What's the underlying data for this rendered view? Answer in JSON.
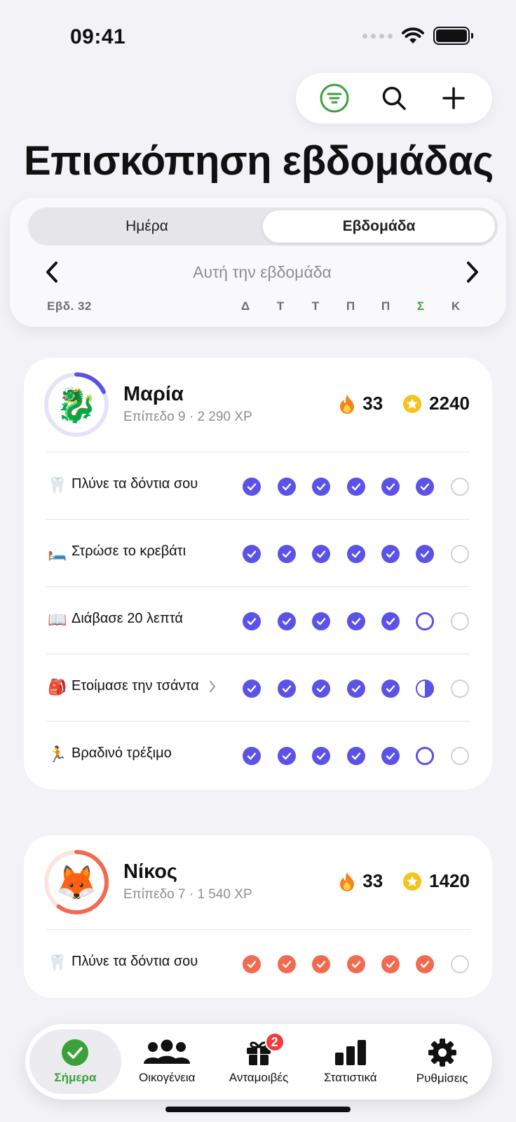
{
  "status_bar": {
    "time": "09:41"
  },
  "page": {
    "title": "Επισκόπηση εβδομάδας"
  },
  "view_toggle": {
    "options": [
      "Ημέρα",
      "Εβδομάδα"
    ],
    "selected": "Εβδομάδα"
  },
  "week": {
    "label": "Αυτή την εβδομάδα",
    "number_label": "Εβδ. 32",
    "days": [
      "Δ",
      "Τ",
      "Τ",
      "Π",
      "Π",
      "Σ",
      "Κ"
    ],
    "today_index": 5
  },
  "members": [
    {
      "name": "Μαρία",
      "subtitle": "Επίπεδο 9 · 2 290 XP",
      "avatar_emoji": "🐉",
      "streak": "33",
      "points": "2240",
      "ring_color": "#5b52e8",
      "ring_track_color": "#e4e3fb",
      "level_progress": 0.18,
      "habits": [
        {
          "emoji": "🦷",
          "label": "Πλύνε τα δόντια σου",
          "states": [
            "done",
            "done",
            "done",
            "done",
            "done",
            "done",
            "empty"
          ]
        },
        {
          "emoji": "🛏️",
          "label": "Στρώσε το κρεβάτι",
          "states": [
            "done",
            "done",
            "done",
            "done",
            "done",
            "done",
            "empty"
          ]
        },
        {
          "emoji": "📖",
          "label": "Διάβασε 20 λεπτά",
          "states": [
            "done",
            "done",
            "done",
            "done",
            "done",
            "ring",
            "empty"
          ]
        },
        {
          "emoji": "🎒",
          "label": "Ετοίμασε την τσάντα",
          "has_chevron": true,
          "states": [
            "done",
            "done",
            "done",
            "done",
            "done",
            "half",
            "empty"
          ]
        },
        {
          "emoji": "🏃",
          "label": "Βραδινό τρέξιμο",
          "states": [
            "done",
            "done",
            "done",
            "done",
            "done",
            "ring",
            "empty"
          ]
        }
      ]
    },
    {
      "name": "Νίκος",
      "subtitle": "Επίπεδο 7 · 1 540 XP",
      "avatar_emoji": "🦊",
      "streak": "33",
      "points": "1420",
      "ring_color": "#f26b50",
      "ring_track_color": "#fde4de",
      "level_progress": 0.6,
      "habits": [
        {
          "emoji": "🦷",
          "label": "Πλύνε τα δόντια σου",
          "states": [
            "done",
            "done",
            "done",
            "done",
            "done",
            "done",
            "empty"
          ]
        }
      ]
    }
  ],
  "tab_bar": {
    "items": [
      {
        "label": "Σήμερα",
        "icon": "check-circle-icon",
        "active": true
      },
      {
        "label": "Οικογένεια",
        "icon": "people-icon"
      },
      {
        "label": "Ανταμοιβές",
        "icon": "gift-icon",
        "badge": "2"
      },
      {
        "label": "Στατιστικά",
        "icon": "bar-chart-icon"
      },
      {
        "label": "Ρυθμίσεις",
        "icon": "gear-icon"
      }
    ]
  },
  "colors": {
    "accent_green": "#3aa13a",
    "purple": "#5b52e8",
    "orange": "#f26b50",
    "badge_red": "#f23b3b"
  }
}
